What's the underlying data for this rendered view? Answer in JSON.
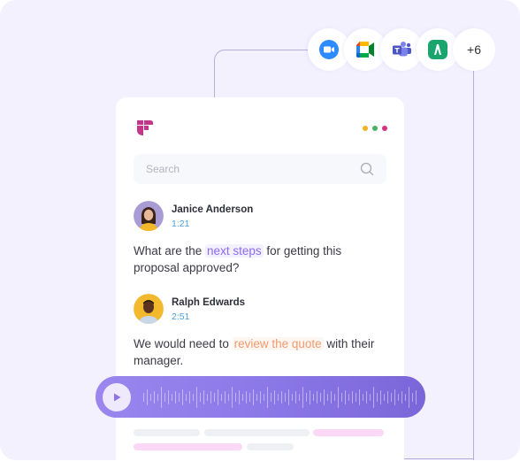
{
  "integrations": {
    "apps": [
      {
        "name": "Zoom",
        "icon": "zoom-icon",
        "color": "#2d8cff"
      },
      {
        "name": "Google Meet",
        "icon": "google-meet-icon",
        "color": "#00ac47"
      },
      {
        "name": "Microsoft Teams",
        "icon": "teams-icon",
        "color": "#5b5fc7"
      },
      {
        "name": "Avoma",
        "icon": "avoma-icon",
        "color": "#1aa56f"
      }
    ],
    "more_label": "+6"
  },
  "card": {
    "logo_color": "#c2378b",
    "window_dots": [
      "#f4b124",
      "#4caf66",
      "#d6337f"
    ],
    "search": {
      "placeholder": "Search",
      "value": ""
    },
    "messages": [
      {
        "author": "Janice Anderson",
        "time": "1:21",
        "text_before": "What are the ",
        "highlight": "next steps",
        "text_after": " for getting this proposal approved?",
        "highlight_color": "#8a6cf0",
        "avatar_bg": "#a99bd4"
      },
      {
        "author": "Ralph Edwards",
        "time": "2:51",
        "text_before": "We would need to ",
        "highlight": "review the quote",
        "text_after": " with their manager.",
        "highlight_color": "#f29a6e",
        "avatar_bg": "#f2b92c"
      }
    ]
  },
  "player": {
    "play_icon": "play-icon",
    "progress": 0
  }
}
